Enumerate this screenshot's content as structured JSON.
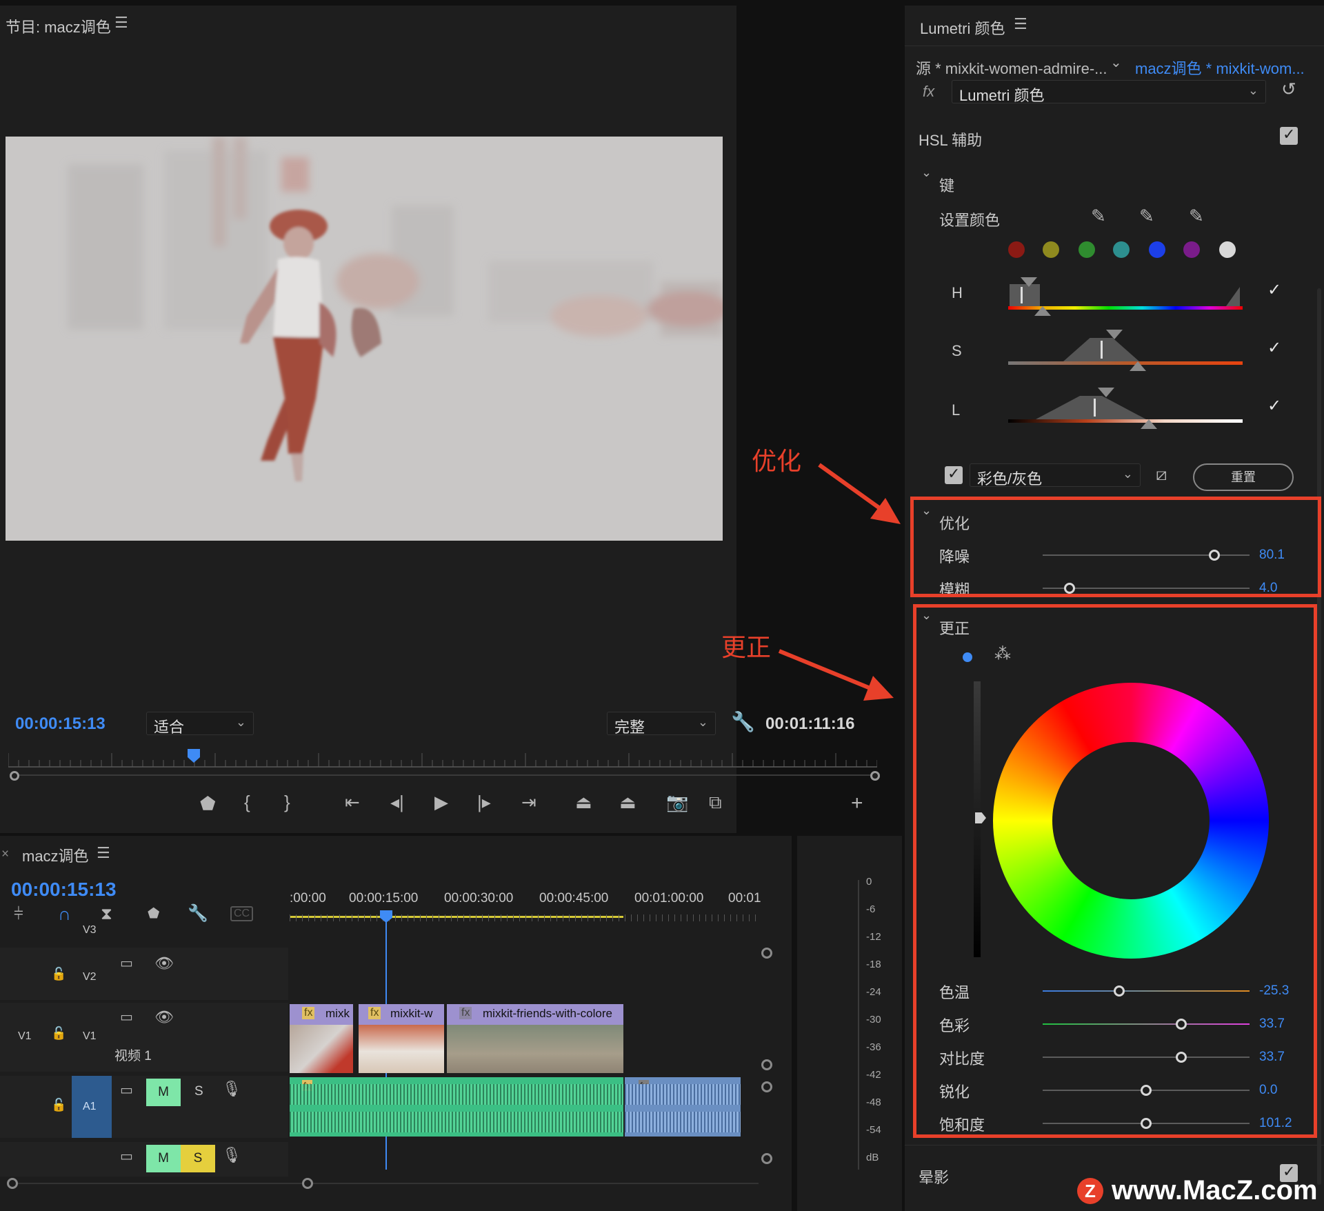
{
  "program_monitor": {
    "title": "节目: macz调色",
    "current_time": "00:00:15:13",
    "zoom": "适合",
    "quality": "完整",
    "duration": "00:01:11:16"
  },
  "lumetri": {
    "title": "Lumetri 颜色",
    "source_tab": "源 * mixkit-women-admire-...",
    "sequence_tab": "macz调色 * mixkit-wom...",
    "effect_select": "Lumetri 颜色",
    "hsl_section": "HSL 辅助",
    "key_section": "键",
    "set_color_label": "设置颜色",
    "h_label": "H",
    "s_label": "S",
    "l_label": "L",
    "display_mode": "彩色/灰色",
    "reset_button": "重置",
    "refine_section": "优化",
    "denoise_label": "降噪",
    "denoise_value": "80.1",
    "denoise_fraction": 0.83,
    "blur_label": "模糊",
    "blur_value": "4.0",
    "blur_fraction": 0.13,
    "correction_section": "更正",
    "temperature_label": "色温",
    "temperature_value": "-25.3",
    "temperature_fraction": 0.37,
    "tint_label": "色彩",
    "tint_value": "33.7",
    "tint_fraction": 0.67,
    "contrast_label": "对比度",
    "contrast_value": "33.7",
    "contrast_fraction": 0.67,
    "sharpen_label": "锐化",
    "sharpen_value": "0.0",
    "sharpen_fraction": 0.5,
    "saturation_label": "饱和度",
    "saturation_value": "101.2",
    "saturation_fraction": 0.5,
    "vignette_section": "晕影",
    "swatch_colors": [
      "#8b1a14",
      "#8f8a1f",
      "#2f8c2f",
      "#2d8f8f",
      "#1c3fe8",
      "#7a1c8a",
      "#d8d8d8"
    ]
  },
  "annotations": {
    "refine": "优化",
    "correction": "更正"
  },
  "timeline": {
    "title": "macz调色",
    "current_time": "00:00:15:13",
    "ruler": [
      ":00:00",
      "00:00:15:00",
      "00:00:30:00",
      "00:00:45:00",
      "00:01:00:00",
      "00:01"
    ],
    "tracks": {
      "v3": "V3",
      "v2": "V2",
      "v1": "V1",
      "v1_src": "V1",
      "v1_name": "视频 1",
      "a1": "A1"
    },
    "mute": "M",
    "solo": "S",
    "clips": [
      "mixk",
      "mixkit-w",
      "mixkit-friends-with-colore"
    ],
    "fx_label": "fx"
  },
  "meter": {
    "labels": [
      "0",
      "-6",
      "-12",
      "-18",
      "-24",
      "-30",
      "-36",
      "-42",
      "-48",
      "-54",
      "dB"
    ]
  },
  "watermark": "www.MacZ.com"
}
